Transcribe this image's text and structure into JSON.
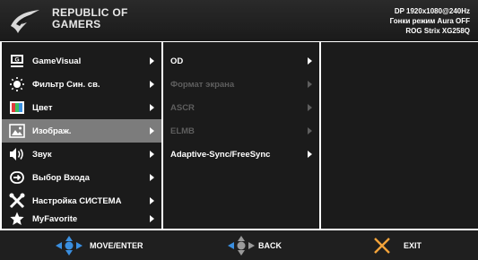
{
  "header": {
    "brand_line1": "REPUBLIC OF",
    "brand_line2": "GAMERS",
    "status_line1": "DP 1920x1080@240Hz",
    "status_line2": "Гонки режим  Aura OFF",
    "status_line3": "ROG Strix XG258Q"
  },
  "main_menu": {
    "items": [
      {
        "label": "GameVisual",
        "icon": "gamevisual-icon"
      },
      {
        "label": "Фильтр Син. св.",
        "icon": "blue-light-filter-icon"
      },
      {
        "label": "Цвет",
        "icon": "color-icon"
      },
      {
        "label": "Изображ.",
        "icon": "image-icon",
        "selected": true
      },
      {
        "label": "Звук",
        "icon": "speaker-icon"
      },
      {
        "label": "Выбор Входа",
        "icon": "input-select-icon"
      },
      {
        "label": "Настройка СИСТЕМА",
        "icon": "wrench-icon"
      },
      {
        "label": "MyFavorite",
        "icon": "star-icon"
      }
    ]
  },
  "sub_menu": {
    "items": [
      {
        "label": "OD",
        "enabled": true
      },
      {
        "label": "Формат экрана",
        "enabled": false
      },
      {
        "label": "ASCR",
        "enabled": false
      },
      {
        "label": "ELMB",
        "enabled": false
      },
      {
        "label": "Adaptive-Sync/FreeSync",
        "enabled": true
      }
    ]
  },
  "footer": {
    "move_label": "MOVE/ENTER",
    "back_label": "BACK",
    "exit_label": "EXIT"
  },
  "colors": {
    "panel_bg": "#1b1b1b",
    "selected_bg": "#7c7c7c",
    "accent_blue": "#3a8fe0",
    "exit_orange": "#f2a33a",
    "disabled_text": "#5e5e5e"
  }
}
